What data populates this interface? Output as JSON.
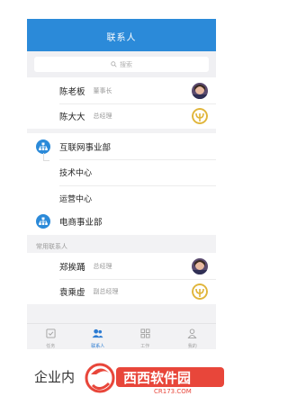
{
  "header": {
    "title": "联系人"
  },
  "search": {
    "placeholder": "搜索"
  },
  "leaders": [
    {
      "name": "陈老板",
      "role": "董事长",
      "avatar": "face-photo"
    },
    {
      "name": "陈大大",
      "role": "总经理",
      "avatar": "yellow-emblem"
    }
  ],
  "departments": [
    {
      "name": "互联网事业部",
      "children": [
        "技术中心",
        "运营中心"
      ]
    },
    {
      "name": "电商事业部",
      "children": []
    }
  ],
  "frequent": {
    "label": "常用联系人",
    "contacts": [
      {
        "name": "郑挨踊",
        "role": "总经理",
        "avatar": "face-photo"
      },
      {
        "name": "袁乘虚",
        "role": "副总经理",
        "avatar": "yellow-emblem"
      }
    ]
  },
  "tabs": [
    {
      "label": "任务",
      "icon": "task-icon",
      "active": false
    },
    {
      "label": "联系人",
      "icon": "contacts-icon",
      "active": true
    },
    {
      "label": "工作",
      "icon": "grid-icon",
      "active": false
    },
    {
      "label": "我的",
      "icon": "profile-icon",
      "active": false
    }
  ],
  "caption": "企业内",
  "watermark": {
    "brand": "西西软件园",
    "url": "CR173.COM"
  },
  "colors": {
    "primary": "#2b8ad9",
    "emblem": "#e0b53a",
    "watermark": "#e8463a"
  }
}
